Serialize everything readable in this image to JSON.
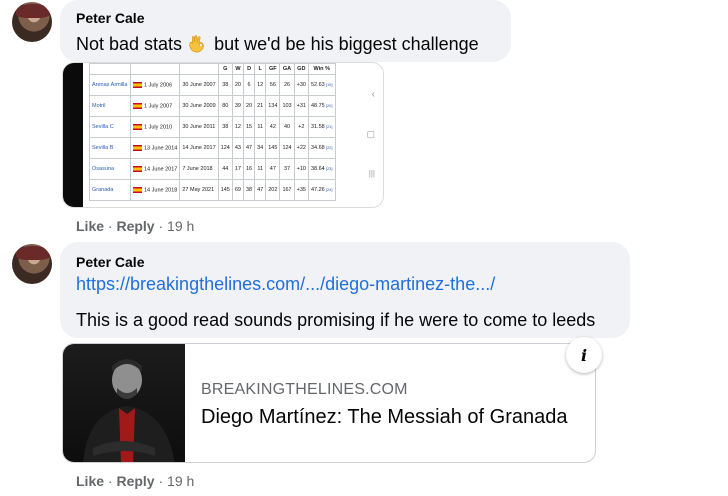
{
  "comments": [
    {
      "author": "Peter Cale",
      "text_before": "Not bad stats",
      "text_after": "but we'd be his biggest challenge",
      "emoji_icon": "ok-hand-icon",
      "actions": {
        "like": "Like",
        "reply": "Reply",
        "time": "19 h"
      },
      "attachment": {
        "columns": [
          "G",
          "W",
          "D",
          "L",
          "GF",
          "GA",
          "GD",
          "Win %"
        ],
        "rows": [
          {
            "club": "Arenas Armilla",
            "from": "1 July 2006",
            "to": "30 June 2007",
            "g": "38",
            "w": "20",
            "d": "6",
            "l": "12",
            "gf": "56",
            "ga": "26",
            "gd": "+30",
            "win": "52.63",
            "ref": "[19]"
          },
          {
            "club": "Motril",
            "from": "1 July 2007",
            "to": "30 June 2009",
            "g": "80",
            "w": "39",
            "d": "20",
            "l": "21",
            "gf": "134",
            "ga": "103",
            "gd": "+31",
            "win": "48.75",
            "ref": "[20]"
          },
          {
            "club": "Sevilla C",
            "from": "1 July 2010",
            "to": "30 June 2011",
            "g": "38",
            "w": "12",
            "d": "15",
            "l": "11",
            "gf": "42",
            "ga": "40",
            "gd": "+2",
            "win": "31.58",
            "ref": "[21]"
          },
          {
            "club": "Sevilla B",
            "from": "13 June 2014",
            "to": "14 June 2017",
            "g": "124",
            "w": "43",
            "d": "47",
            "l": "34",
            "gf": "145",
            "ga": "124",
            "gd": "+22",
            "win": "34.68",
            "ref": "[22]"
          },
          {
            "club": "Osasuna",
            "from": "14 June 2017",
            "to": "7 June 2018",
            "g": "44",
            "w": "17",
            "d": "16",
            "l": "11",
            "gf": "47",
            "ga": "37",
            "gd": "+10",
            "win": "38.64",
            "ref": "[23]"
          },
          {
            "club": "Granada",
            "from": "14 June 2018",
            "to": "27 May 2021",
            "g": "145",
            "w": "69",
            "d": "38",
            "l": "47",
            "gf": "202",
            "ga": "167",
            "gd": "+35",
            "win": "47.26",
            "ref": "[24]"
          }
        ]
      }
    },
    {
      "author": "Peter Cale",
      "link": "https://breakingthelines.com/.../diego-martinez-the.../",
      "text": "This is a good read sounds promising if he were to come to leeds",
      "preview": {
        "domain": "BREAKINGTHELINES.COM",
        "title": "Diego Martínez: The Messiah of Granada",
        "info_icon": "info-icon"
      },
      "actions": {
        "like": "Like",
        "reply": "Reply",
        "time": "19 h"
      }
    }
  ]
}
